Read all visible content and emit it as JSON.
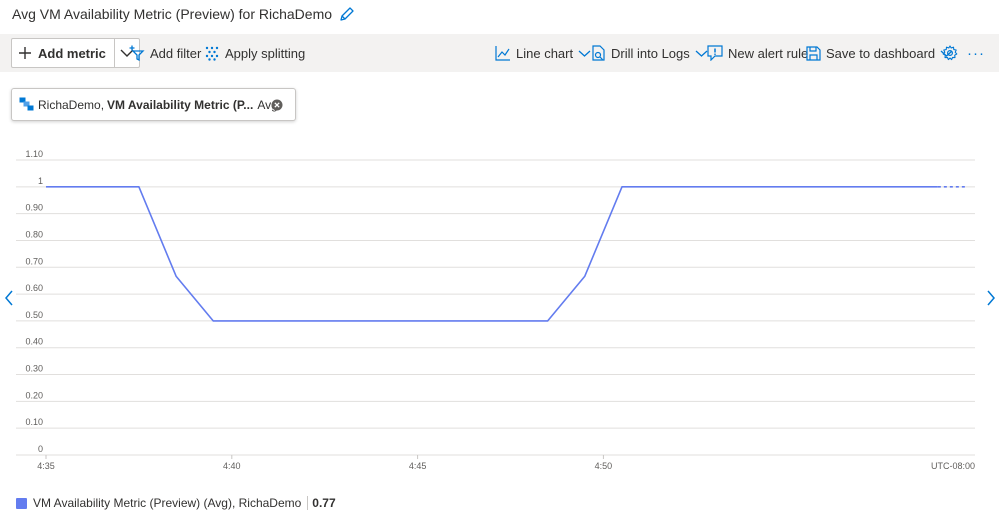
{
  "page_title": "Avg VM Availability Metric (Preview) for RichaDemo",
  "toolbar": {
    "add_metric": "Add metric",
    "add_filter": "Add filter",
    "apply_splitting": "Apply splitting",
    "line_chart": "Line chart",
    "drill_into_logs": "Drill into Logs",
    "new_alert_rule": "New alert rule",
    "save_to_dashboard": "Save to dashboard",
    "more": "···"
  },
  "metric_pill": {
    "resource": "RichaDemo,",
    "metric": "VM Availability Metric (P...",
    "aggregation": "Avg"
  },
  "colors": {
    "series": "#637cef",
    "accent": "#0078d4",
    "toolbar_bg": "#f3f2f1",
    "gridline": "#e1dfdd"
  },
  "chart_data": {
    "type": "line",
    "title": "",
    "xlabel": "",
    "ylabel": "",
    "ylim": [
      0,
      1.1
    ],
    "y_ticks": [
      "1.10",
      "1",
      "0.90",
      "0.80",
      "0.70",
      "0.60",
      "0.50",
      "0.40",
      "0.30",
      "0.20",
      "0.10",
      "0"
    ],
    "x_ticks": [
      "4:35",
      "4:40",
      "4:45",
      "4:50"
    ],
    "timezone_label": "UTC-08:00",
    "grid": true,
    "legend_position": "bottom-left",
    "series": [
      {
        "name": "VM Availability Metric (Preview) (Avg), RichaDemo",
        "summary_value": "0.77",
        "points": [
          {
            "t": "4:35",
            "v": 1
          },
          {
            "t": "4:37:30",
            "v": 1
          },
          {
            "t": "4:38:30",
            "v": 0.6667
          },
          {
            "t": "4:39:30",
            "v": 0.5
          },
          {
            "t": "4:48:30",
            "v": 0.5
          },
          {
            "t": "4:49:30",
            "v": 0.6667
          },
          {
            "t": "4:50:30",
            "v": 1
          },
          {
            "t": "4:59",
            "v": 1
          }
        ],
        "dashed_tail_to": "4:59:45"
      }
    ]
  }
}
